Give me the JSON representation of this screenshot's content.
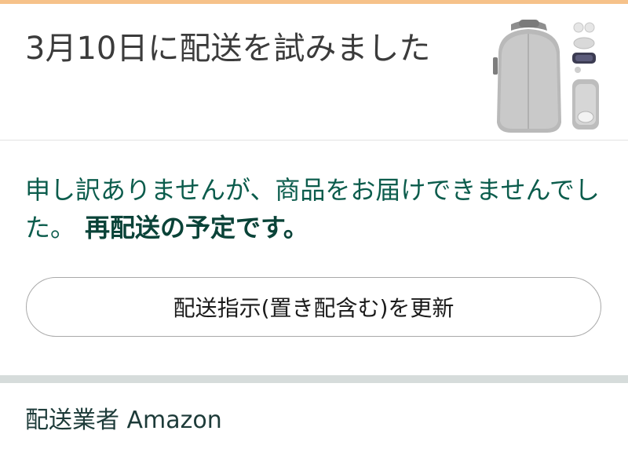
{
  "status": {
    "title": "3月10日に配送を試みました"
  },
  "product": {
    "image_alt": "VRヘッドセット収納ケース"
  },
  "message": {
    "text": "申し訳ありませんが、商品をお届けできませんでした。",
    "emphasis": "再配送の予定です。"
  },
  "actions": {
    "update_label": "配送指示(置き配含む)を更新"
  },
  "carrier": {
    "label": "配送業者 Amazon"
  },
  "colors": {
    "accent": "#f6c28a",
    "message": "#0b5c4c",
    "divider": "#d6dcdb"
  }
}
